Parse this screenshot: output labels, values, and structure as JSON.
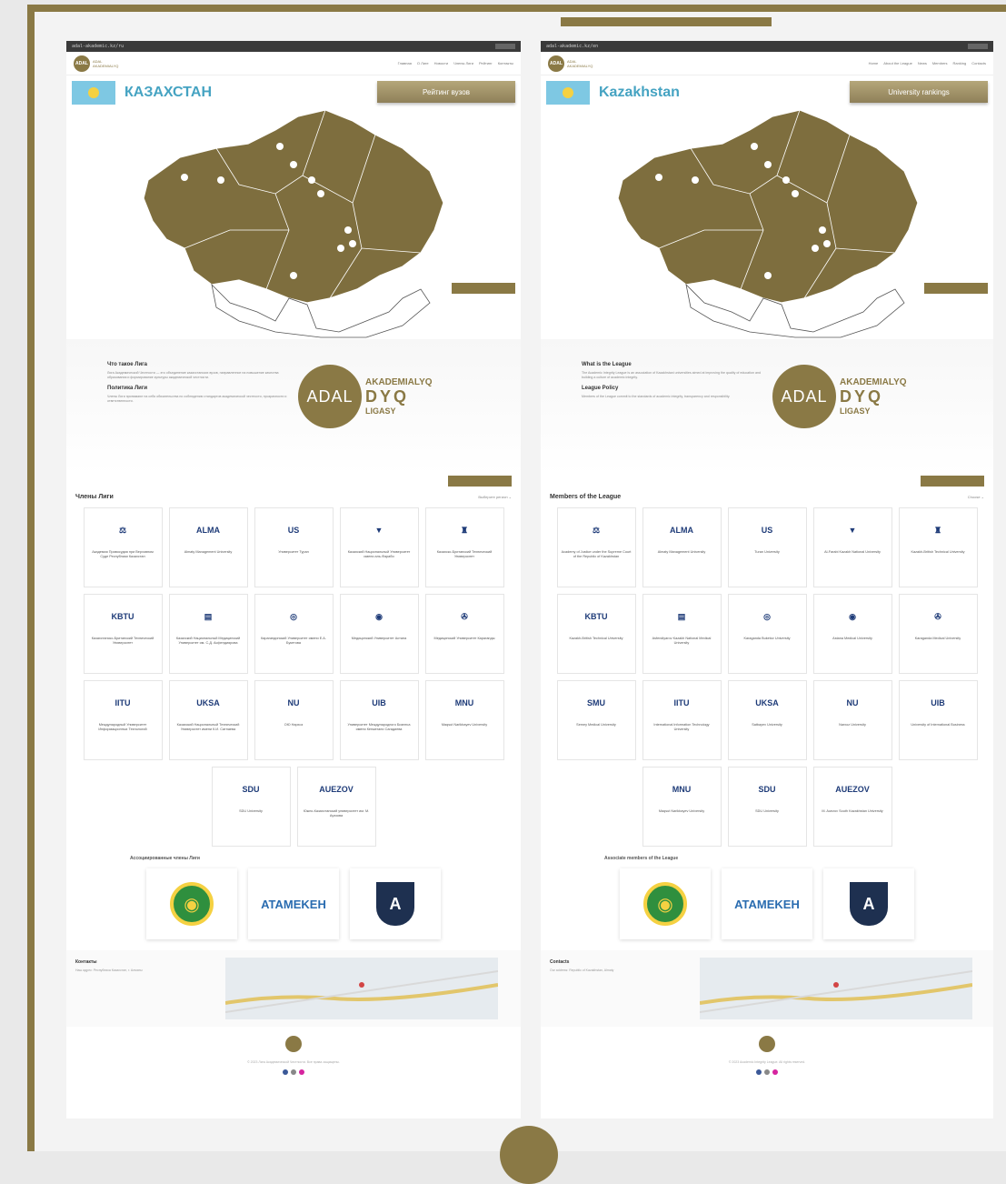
{
  "ru": {
    "browser_url": "adal-akademic.kz/ru",
    "nav": [
      "Главная",
      "О Лиге",
      "Новости",
      "Члены Лиги",
      "Рейтинг",
      "Контакты"
    ],
    "logo_text": "ADAL AKADEMIALYQ",
    "country": "КАЗАХСТАН",
    "rank_button": "Рейтинг вузов",
    "about_title1": "Что такое Лига",
    "about_text1": "Лига Академической Честности — это объединение казахстанских вузов, направленное на повышение качества образования и формирование культуры академической честности.",
    "about_title2": "Политика Лиги",
    "about_text2": "Члены Лиги принимают на себя обязательства по соблюдению стандартов академической честности, прозрачности и ответственности.",
    "members_title": "Члены Лиги",
    "members_select": "Выберите регион ⌄",
    "members": [
      {
        "logo": "⚖",
        "name": "Академия Правосудия при Верховном Суде Республики Казахстан"
      },
      {
        "logo": "ALMA",
        "name": "Almaty Management University"
      },
      {
        "logo": "US",
        "name": "Университет Туран"
      },
      {
        "logo": "▼",
        "name": "Казахский Национальный Университет имени аль-Фараби"
      },
      {
        "logo": "♜",
        "name": "Казахско-Британский Технический Университет"
      },
      {
        "logo": "KBTU",
        "name": "Казахстанско-Британский Технический Университет"
      },
      {
        "logo": "▤",
        "name": "Казахский Национальный Медицинский Университет им. С.Д. Асфендиярова"
      },
      {
        "logo": "◎",
        "name": "Карагандинский Университет имени Е.А. Букетова"
      },
      {
        "logo": "◉",
        "name": "Медицинский Университет Астана"
      },
      {
        "logo": "✇",
        "name": "Медицинский Университет Караганды"
      },
      {
        "logo": "IITU",
        "name": "Международный Университет Информационных Технологий"
      },
      {
        "logo": "UKSA",
        "name": "Казахский Национальный Технический Университет имени К.И. Сатпаева"
      },
      {
        "logo": "NU",
        "name": "ОЮ Нархоз"
      },
      {
        "logo": "UIB",
        "name": "Университет Международного Бизнеса имени Кенжегали Сагадиева"
      },
      {
        "logo": "MNU",
        "name": "Maqsut Narikbayev University"
      },
      {
        "logo": "SDU",
        "name": "SDU University"
      },
      {
        "logo": "AUEZOV",
        "name": "Южно-Казахстанский университет им. М. Ауэзова"
      }
    ],
    "assoc_title": "Ассоциированные члены Лиги",
    "assoc": [
      "◉",
      "ATAMEKEH",
      "A"
    ],
    "contacts_title": "Контакты",
    "contacts_text": "Наш адрес: Республика Казахстан, г. Алматы",
    "footer_text": "© 2023 Лига Академической Честности. Все права защищены."
  },
  "en": {
    "browser_url": "adal-akademic.kz/en",
    "nav": [
      "Home",
      "About the League",
      "News",
      "Members",
      "Ranking",
      "Contacts"
    ],
    "logo_text": "ADAL AKADEMIALYQ",
    "country": "Kazakhstan",
    "rank_button": "University rankings",
    "about_title1": "What is the League",
    "about_text1": "The Academic Integrity League is an association of Kazakhstani universities aimed at improving the quality of education and building a culture of academic integrity.",
    "about_title2": "League Policy",
    "about_text2": "Members of the League commit to the standards of academic integrity, transparency and responsibility.",
    "members_title": "Members of the League",
    "members_select": "Choose ⌄",
    "members": [
      {
        "logo": "⚖",
        "name": "Academy of Justice under the Supreme Court of the Republic of Kazakhstan"
      },
      {
        "logo": "ALMA",
        "name": "Almaty Management University"
      },
      {
        "logo": "US",
        "name": "Turan University"
      },
      {
        "logo": "▼",
        "name": "Al-Farabi Kazakh National University"
      },
      {
        "logo": "♜",
        "name": "Kazakh-British Technical University"
      },
      {
        "logo": "KBTU",
        "name": "Kazakh-British Technical University"
      },
      {
        "logo": "▤",
        "name": "Asfendiyarov Kazakh National Medical University"
      },
      {
        "logo": "◎",
        "name": "Karaganda Buketov University"
      },
      {
        "logo": "◉",
        "name": "Astana Medical University"
      },
      {
        "logo": "✇",
        "name": "Karaganda Medical University"
      },
      {
        "logo": "SMU",
        "name": "Semey Medical University"
      },
      {
        "logo": "IITU",
        "name": "International Information Technology University"
      },
      {
        "logo": "UKSA",
        "name": "Satbayev University"
      },
      {
        "logo": "NU",
        "name": "Narxoz University"
      },
      {
        "logo": "UIB",
        "name": "University of International Business"
      },
      {
        "logo": "MNU",
        "name": "Maqsut Narikbayev University"
      },
      {
        "logo": "SDU",
        "name": "SDU University"
      },
      {
        "logo": "AUEZOV",
        "name": "M. Auezov South Kazakhstan University"
      }
    ],
    "assoc_title": "Associate members of the League",
    "assoc": [
      "◉",
      "ATAMEKEH",
      "A"
    ],
    "contacts_title": "Contacts",
    "contacts_text": "Our address: Republic of Kazakhstan, Almaty",
    "footer_text": "© 2023 Academic Integrity League. All rights reserved."
  },
  "colors": {
    "gold": "#8a7945",
    "sky": "#45a3c2",
    "flag": "#7ec8e3"
  }
}
